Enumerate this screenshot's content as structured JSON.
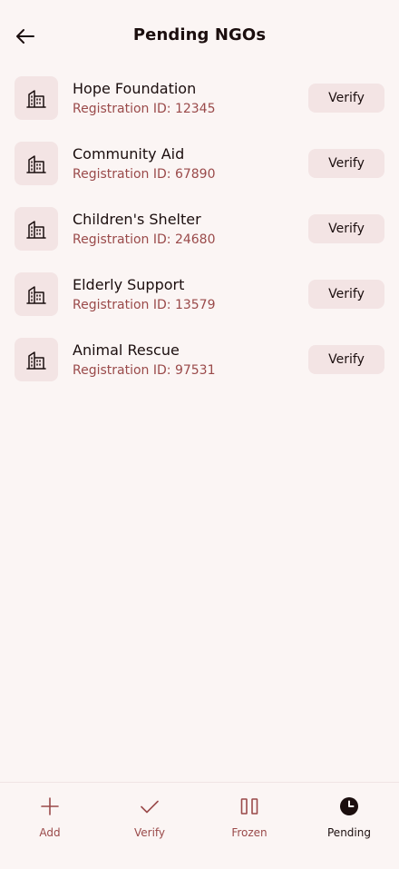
{
  "header": {
    "title": "Pending NGOs",
    "back_icon": "arrow-left-icon"
  },
  "ngos": [
    {
      "name": "Hope Foundation",
      "registration": "Registration ID: 12345",
      "action": "Verify",
      "icon": "building-icon"
    },
    {
      "name": "Community Aid",
      "registration": "Registration ID: 67890",
      "action": "Verify",
      "icon": "building-icon"
    },
    {
      "name": "Children's Shelter",
      "registration": "Registration ID: 24680",
      "action": "Verify",
      "icon": "building-icon"
    },
    {
      "name": "Elderly Support",
      "registration": "Registration ID: 13579",
      "action": "Verify",
      "icon": "building-icon"
    },
    {
      "name": "Animal Rescue",
      "registration": "Registration ID: 97531",
      "action": "Verify",
      "icon": "building-icon"
    }
  ],
  "bottom_nav": {
    "items": [
      {
        "label": "Add",
        "icon": "plus-icon",
        "active": false
      },
      {
        "label": "Verify",
        "icon": "check-icon",
        "active": false
      },
      {
        "label": "Frozen",
        "icon": "pause-icon",
        "active": false
      },
      {
        "label": "Pending",
        "icon": "clock-icon",
        "active": true
      }
    ]
  },
  "colors": {
    "background": "#fbf5f4",
    "surface": "#f3e4e4",
    "text_primary": "#1b0e0e",
    "text_secondary": "#9a4a4a"
  }
}
